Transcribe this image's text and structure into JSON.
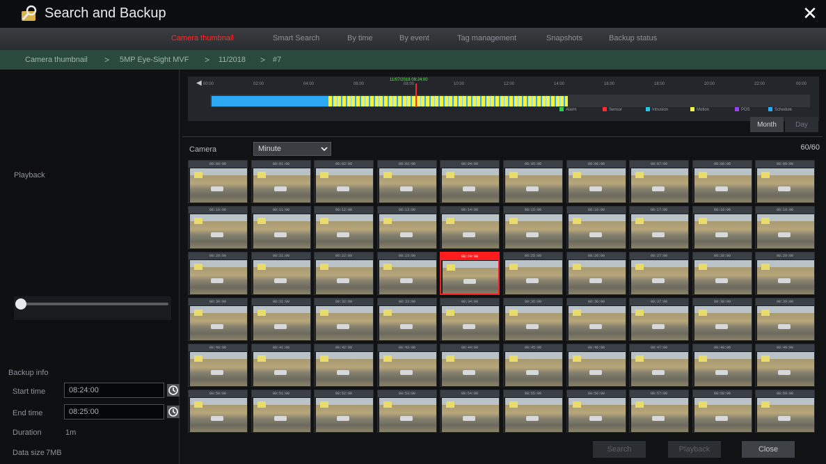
{
  "window": {
    "title": "Search and Backup"
  },
  "tabs": [
    {
      "label": "Camera thumbnail",
      "active": true
    },
    {
      "label": "Smart Search",
      "active": false
    },
    {
      "label": "By time",
      "active": false
    },
    {
      "label": "By event",
      "active": false
    },
    {
      "label": "Tag management",
      "active": false
    },
    {
      "label": "Snapshots",
      "active": false
    },
    {
      "label": "Backup status",
      "active": false
    }
  ],
  "breadcrumb": [
    "Camera thumbnail",
    "5MP Eye-Sight MVF",
    "11/2018",
    "#7"
  ],
  "left": {
    "playback_label": "Playback",
    "backup": {
      "title": "Backup info",
      "start_label": "Start time",
      "start_value": "08:24:00",
      "end_label": "End time",
      "end_value": "08:25:00",
      "duration_label": "Duration",
      "duration_value": "1m",
      "size_label": "Data size",
      "size_value": "7MB"
    }
  },
  "timeline": {
    "current_time": "11/07/2018 08:24:00",
    "hours": [
      "00:00",
      "02:00",
      "04:00",
      "06:00",
      "08:00",
      "10:00",
      "12:00",
      "14:00",
      "16:00",
      "18:00",
      "20:00",
      "22:00",
      "00:00"
    ],
    "legend": [
      {
        "label": "Alarm",
        "color": "#2fd04a"
      },
      {
        "label": "Sensor",
        "color": "#ff2a2a"
      },
      {
        "label": "Intrusion",
        "color": "#22c6e8"
      },
      {
        "label": "Motion",
        "color": "#f2f247"
      },
      {
        "label": "POS",
        "color": "#9b3df0"
      },
      {
        "label": "Schedule",
        "color": "#2ca8f4"
      }
    ],
    "month_button": "Month",
    "day_button": "Day"
  },
  "filter": {
    "camera_label": "Camera",
    "interval": "Minute",
    "counter": "60/60"
  },
  "thumbnails": [
    "08:00:00",
    "08:01:00",
    "08:02:00",
    "08:03:00",
    "08:04:00",
    "08:05:00",
    "08:06:00",
    "08:07:00",
    "08:08:00",
    "08:09:00",
    "08:10:00",
    "08:11:00",
    "08:12:00",
    "08:13:00",
    "08:14:00",
    "08:15:00",
    "08:16:00",
    "08:17:00",
    "08:18:00",
    "08:19:00",
    "08:20:00",
    "08:21:00",
    "08:22:00",
    "08:23:00",
    "08:24:00",
    "08:25:00",
    "08:26:00",
    "08:27:00",
    "08:28:00",
    "08:29:00",
    "08:30:00",
    "08:31:00",
    "08:32:00",
    "08:33:00",
    "08:34:00",
    "08:35:00",
    "08:36:00",
    "08:37:00",
    "08:38:00",
    "08:39:00",
    "08:40:00",
    "08:41:00",
    "08:42:00",
    "08:43:00",
    "08:44:00",
    "08:45:00",
    "08:46:00",
    "08:47:00",
    "08:48:00",
    "08:49:00",
    "08:50:00",
    "08:51:00",
    "08:52:00",
    "08:53:00",
    "08:54:00",
    "08:55:00",
    "08:56:00",
    "08:57:00",
    "08:58:00",
    "08:59:00"
  ],
  "selected_index": 24,
  "buttons": {
    "search": "Search",
    "playback": "Playback",
    "close": "Close"
  }
}
